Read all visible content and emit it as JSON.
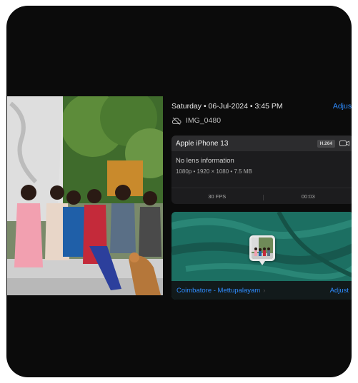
{
  "info": {
    "date_line": "Saturday • 06-Jul-2024 • 3:45 PM",
    "adjust_label": "Adjust",
    "file_name": "IMG_0480"
  },
  "camera": {
    "model": "Apple iPhone 13",
    "codec": "H.264",
    "lens": "No lens information",
    "specs": "1080p • 1920 × 1080 • 7.5 MB",
    "fps": "30 FPS",
    "duration": "00:03"
  },
  "map": {
    "location": "Coimbatore - Mettupalayam",
    "adjust_label": "Adjust"
  },
  "colors": {
    "accent": "#2f8cff",
    "background": "#0b0b0b",
    "card": "#1c1c1e",
    "map_water": "#1d6e63"
  },
  "icons": {
    "cloud_off": "cloud-off-icon",
    "video": "video-icon",
    "chevron": "chevron-right-icon"
  }
}
